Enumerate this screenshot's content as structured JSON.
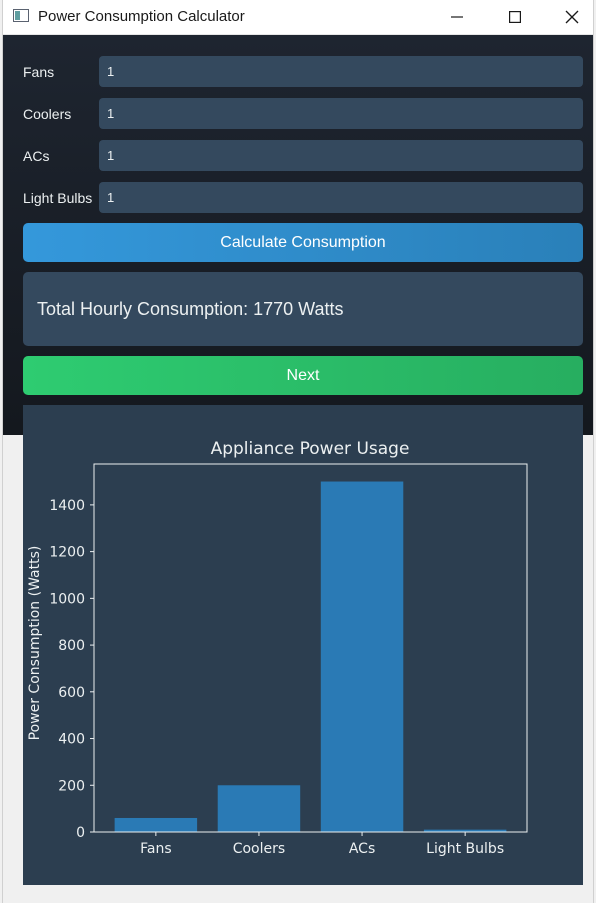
{
  "window": {
    "title": "Power Consumption Calculator"
  },
  "form": {
    "fields": [
      {
        "label": "Fans",
        "value": "1"
      },
      {
        "label": "Coolers",
        "value": "1"
      },
      {
        "label": "ACs",
        "value": "1"
      },
      {
        "label": "Light Bulbs",
        "value": "1"
      }
    ],
    "calculate_label": "Calculate Consumption",
    "result_text": "Total Hourly Consumption: 1770 Watts",
    "next_label": "Next"
  },
  "colors": {
    "accent_blue": "#3498db",
    "accent_green": "#2ecc71",
    "panel": "#34495e",
    "chart_bg": "#2c3e50",
    "bar": "#2a7ab5"
  },
  "chart_data": {
    "type": "bar",
    "title": "Appliance Power Usage",
    "xlabel": "",
    "ylabel": "Power Consumption (Watts)",
    "categories": [
      "Fans",
      "Coolers",
      "ACs",
      "Light Bulbs"
    ],
    "values": [
      60,
      200,
      1500,
      10
    ],
    "ylim": [
      0,
      1575
    ],
    "yticks": [
      0,
      200,
      400,
      600,
      800,
      1000,
      1200,
      1400
    ],
    "grid": false
  }
}
